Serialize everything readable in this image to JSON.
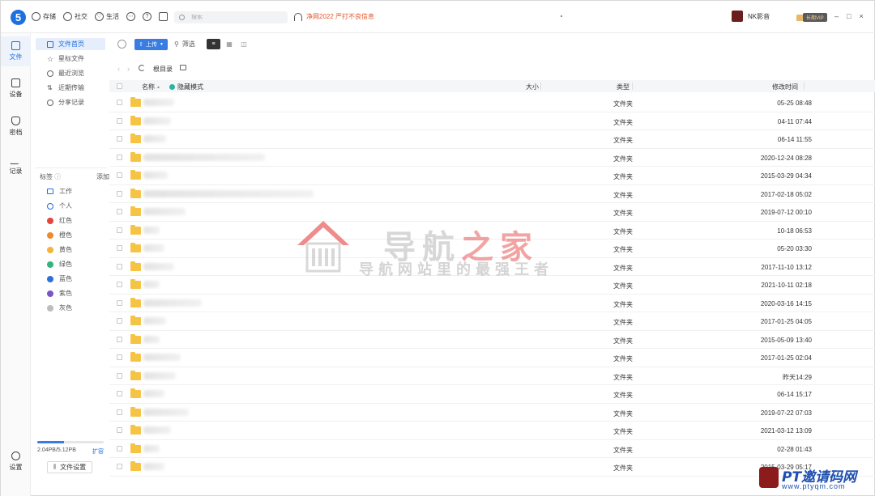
{
  "app": {
    "logo_glyph": "5",
    "nav": [
      {
        "icon": "cloud-icon",
        "label": "存储"
      },
      {
        "icon": "social-icon",
        "label": "社交"
      },
      {
        "icon": "heart-icon",
        "label": "生活"
      }
    ],
    "extra_icons": [
      "more-icon",
      "help-icon",
      "message-icon"
    ],
    "search_placeholder": "搜索",
    "notice": "净网2022 严打不良信息",
    "user_name": "NK影音",
    "vip_label": "长期VIP",
    "window_controls": [
      "–",
      "□",
      "×"
    ]
  },
  "rail": [
    {
      "icon": "file-icon",
      "label": "文件",
      "active": true
    },
    {
      "icon": "device-icon",
      "label": "设备",
      "active": false
    },
    {
      "icon": "safe-icon",
      "label": "密档",
      "active": false
    },
    {
      "icon": "note-icon",
      "label": "记录",
      "active": false
    },
    {
      "icon": "settings-icon",
      "label": "设置",
      "active": false
    }
  ],
  "sidenav": {
    "items": [
      {
        "label": "文件首页",
        "active": true
      },
      {
        "label": "星标文件",
        "active": false
      },
      {
        "label": "最近浏览",
        "active": false
      },
      {
        "label": "近期传输",
        "active": false
      },
      {
        "label": "分享记录",
        "active": false
      }
    ],
    "tags_title": "标签",
    "tags_add": "添加",
    "tags": [
      {
        "label": "工作",
        "color": "#3a7de0",
        "kind": "box"
      },
      {
        "label": "个人",
        "color": "#3a7de0",
        "kind": "person"
      },
      {
        "label": "红色",
        "color": "#e5453d",
        "kind": "dot"
      },
      {
        "label": "橙色",
        "color": "#ef8a2c",
        "kind": "dot"
      },
      {
        "label": "黄色",
        "color": "#f2b43a",
        "kind": "dot"
      },
      {
        "label": "绿色",
        "color": "#35b37e",
        "kind": "dot"
      },
      {
        "label": "蓝色",
        "color": "#2f6fd6",
        "kind": "dot"
      },
      {
        "label": "紫色",
        "color": "#7a55c9",
        "kind": "dot"
      },
      {
        "label": "灰色",
        "color": "#bdbdbd",
        "kind": "dot"
      }
    ],
    "storage_used_fraction": 0.4,
    "storage_text": "2.04PB/5.12PB",
    "storage_expand": "扩容",
    "file_settings": "文件设置"
  },
  "toolbar": {
    "upload_label": "上传",
    "filter_label": "筛选"
  },
  "path": {
    "root_label": "根目录"
  },
  "table": {
    "col_name": "名称",
    "col_hidden": "隐藏模式",
    "col_size": "大小",
    "col_type": "类型",
    "col_modified": "修改时间",
    "rows": [
      {
        "type": "文件夹",
        "modified": "05-25 08:48",
        "name_width": 38
      },
      {
        "type": "文件夹",
        "modified": "04-11 07:44",
        "name_width": 34
      },
      {
        "type": "文件夹",
        "modified": "06-14 11:55",
        "name_width": 28
      },
      {
        "type": "文件夹",
        "modified": "2020-12-24 08:28",
        "name_width": 150
      },
      {
        "type": "文件夹",
        "modified": "2015-03-29 04:34",
        "name_width": 30
      },
      {
        "type": "文件夹",
        "modified": "2017-02-18 05:02",
        "name_width": 210
      },
      {
        "type": "文件夹",
        "modified": "2019-07-12 00:10",
        "name_width": 52
      },
      {
        "type": "文件夹",
        "modified": "10-18 06:53",
        "name_width": 20
      },
      {
        "type": "文件夹",
        "modified": "05-20 03:30",
        "name_width": 26
      },
      {
        "type": "文件夹",
        "modified": "2017-11-10 13:12",
        "name_width": 38
      },
      {
        "type": "文件夹",
        "modified": "2021-10-11 02:18",
        "name_width": 20
      },
      {
        "type": "文件夹",
        "modified": "2020-03-16 14:15",
        "name_width": 72
      },
      {
        "type": "文件夹",
        "modified": "2017-01-25 04:05",
        "name_width": 28
      },
      {
        "type": "文件夹",
        "modified": "2015-05-09 13:40",
        "name_width": 20
      },
      {
        "type": "文件夹",
        "modified": "2017-01-25 02:04",
        "name_width": 46
      },
      {
        "type": "文件夹",
        "modified": "昨天14:29",
        "name_width": 40
      },
      {
        "type": "文件夹",
        "modified": "06-14 15:17",
        "name_width": 26
      },
      {
        "type": "文件夹",
        "modified": "2019-07-22 07:03",
        "name_width": 56
      },
      {
        "type": "文件夹",
        "modified": "2021-03-12 13:09",
        "name_width": 34
      },
      {
        "type": "文件夹",
        "modified": "02-28 01:43",
        "name_width": 20
      },
      {
        "type": "文件夹",
        "modified": "2015-03-29 05:17",
        "name_width": 26
      }
    ]
  },
  "watermark": {
    "big_1": "导航",
    "big_2": "之家",
    "small": "导航网站里的最强王者",
    "corner_text": "PT邀请码网",
    "corner_url": "www.ptyqm.com"
  }
}
